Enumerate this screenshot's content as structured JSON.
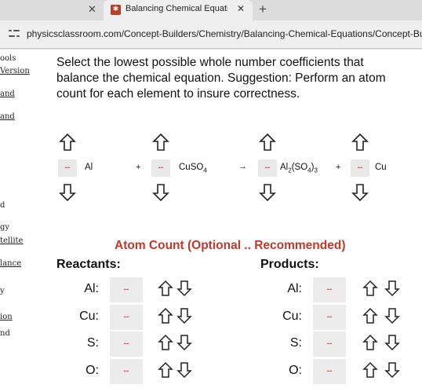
{
  "browser": {
    "tab_title": "Balancing Chemical Equations C",
    "favicon_glyph": "✱",
    "close_glyph": "✕",
    "new_tab_glyph": "+",
    "url": "physicsclassroom.com/Concept-Builders/Chemistry/Balancing-Chemical-Equations/Concept-Builder"
  },
  "sidebar": {
    "links": [
      "ools",
      "Version",
      "and",
      "and",
      "d",
      "gy",
      "tellite",
      "lance",
      "y",
      "ion",
      "nd"
    ]
  },
  "instructions": "Select the lowest possible whole number coefficients that balance the chemical equation.   Suggestion: Perform an atom count for each element to insure correctness.",
  "equation": {
    "coefficient_placeholder": "--",
    "plus": "+",
    "arrow": "→",
    "species": {
      "al": {
        "base": "Al"
      },
      "cuso4": {
        "base": "CuSO",
        "sub1": "4"
      },
      "al2so43": {
        "p1": "Al",
        "s1": "2",
        "p2": "(SO",
        "s2": "4",
        "p3": ")",
        "s3": "3"
      },
      "cu": {
        "base": "Cu"
      }
    }
  },
  "atom_count": {
    "title": "Atom Count (Optional .. Recommended)",
    "reactants_heading": "Reactants:",
    "products_heading": "Products:",
    "placeholder": "--",
    "elements": [
      "Al:",
      "Cu:",
      "S:",
      "O:"
    ]
  },
  "colors": {
    "accent_red": "#c0392b",
    "placeholder_red": "#d44",
    "box_gray": "#ececec"
  }
}
